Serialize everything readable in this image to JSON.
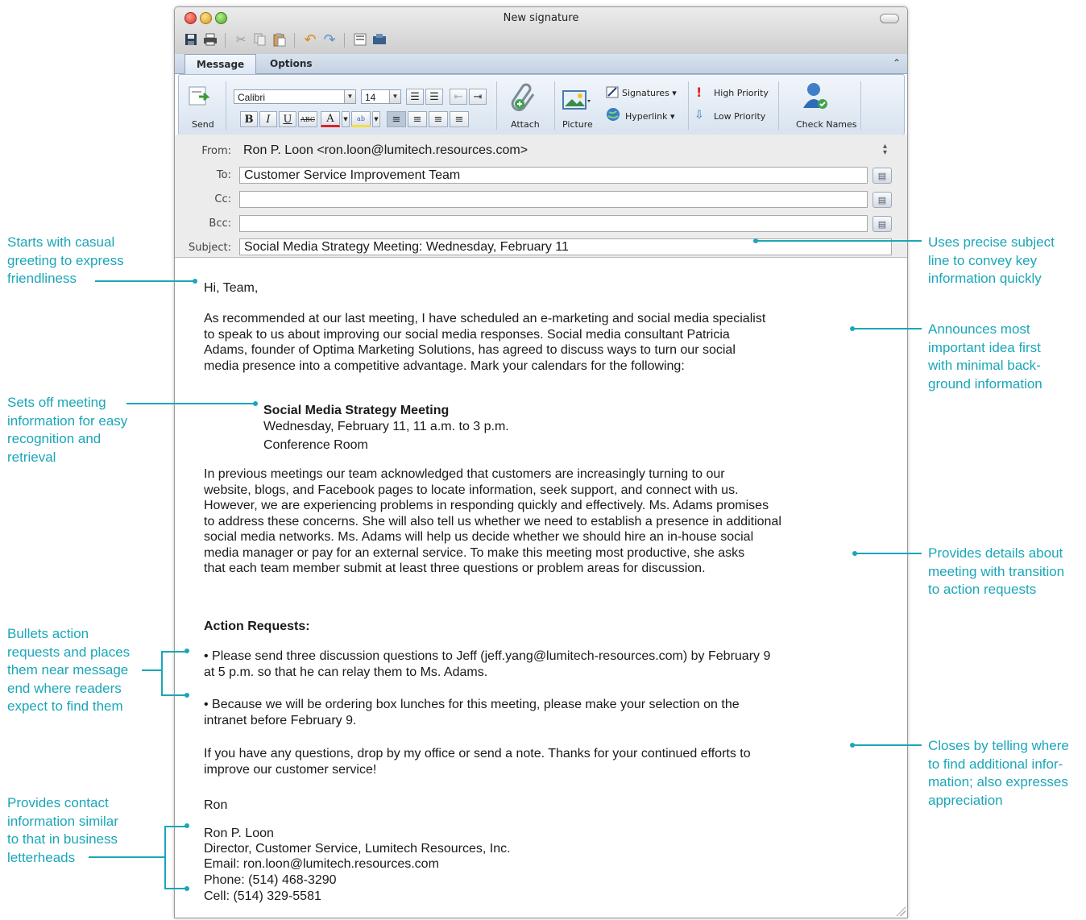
{
  "window": {
    "title": "New signature",
    "tabs": [
      "Message",
      "Options"
    ]
  },
  "ribbon": {
    "send_label": "Send",
    "font_name": "Calibri",
    "font_size": "14",
    "attach_label": "Attach",
    "picture_label": "Picture",
    "signatures_label": "Signatures",
    "hyperlink_label": "Hyperlink",
    "high_priority_label": "High Priority",
    "low_priority_label": "Low Priority",
    "check_names_label": "Check Names",
    "format_buttons": [
      "B",
      "I",
      "U",
      "ABC",
      "A"
    ]
  },
  "header": {
    "from_label": "From:",
    "from_value": "Ron P. Loon <ron.loon@lumitech.resources.com>",
    "to_label": "To:",
    "to_value": "Customer Service Improvement Team",
    "cc_label": "Cc:",
    "cc_value": "",
    "bcc_label": "Bcc:",
    "bcc_value": "",
    "subject_label": "Subject:",
    "subject_value": "Social Media Strategy Meeting: Wednesday, February 11"
  },
  "body": {
    "greeting": "Hi, Team,",
    "para1": "As recommended at our last meeting, I have scheduled an e-marketing and social media specialist\nto speak to us about improving our social media responses. Social media consultant Patricia\nAdams, founder of Optima Marketing Solutions, has agreed to discuss ways to turn our social\nmedia presence into a competitive advantage. Mark your calendars for the following:",
    "meeting_title": "Social Media Strategy Meeting",
    "meeting_time": "Wednesday, February 11, 11 a.m. to 3 p.m.",
    "meeting_place": "Conference Room",
    "para2": "In previous meetings our team acknowledged that customers are increasingly turning to our\nwebsite, blogs, and Facebook pages to locate information, seek support, and connect with us.\nHowever, we are experiencing problems in responding quickly and effectively. Ms. Adams promises\nto address these concerns. She will also tell us whether we need to establish a presence in additional\nsocial media networks. Ms. Adams will help us decide whether we should hire an in-house social\nmedia manager or pay for an external service. To make this meeting most productive, she asks\nthat each team member submit at least three questions or problem areas for discussion.",
    "action_heading": "Action Requests:",
    "bullet1": "• Please send three discussion questions to Jeff (jeff.yang@lumitech-resources.com) by February 9\n   at 5 p.m. so that he can relay them to Ms. Adams.",
    "bullet2": "• Because we will be ordering box lunches for this meeting, please make your selection on the\n   intranet before February 9.",
    "closing": "If you have any questions, drop by my office or send a note. Thanks for your continued efforts to\nimprove our customer service!",
    "sign_name": "Ron",
    "sig_name": "Ron P. Loon",
    "sig_title": "Director, Customer Service, Lumitech Resources, Inc.",
    "sig_email": "Email: ron.loon@lumitech.resources.com",
    "sig_phone": "Phone: (514) 468-3290",
    "sig_cell": "Cell: (514) 329-5581"
  },
  "annotations": {
    "left1": "Starts with casual\ngreeting to express\nfriendliness",
    "left2": "Sets off meeting\ninformation for easy\nrecognition and\nretrieval",
    "left3": "Bullets action\nrequests and places\nthem near message\nend where readers\nexpect to find them",
    "left4": "Provides contact\ninformation similar\nto that in business\nletterheads",
    "right1": "Uses precise subject\nline to convey key\ninformation quickly",
    "right2": "Announces most\nimportant idea first\nwith minimal back-\nground information",
    "right3": "Provides details about\nmeeting with transition\nto action requests",
    "right4": "Closes by telling where\nto find additional infor-\nmation; also expresses\nappreciation"
  },
  "colors": {
    "annotation": "#1ba6b8",
    "ribbon_bg": "#dce6f1",
    "header_bg": "#ececec"
  }
}
